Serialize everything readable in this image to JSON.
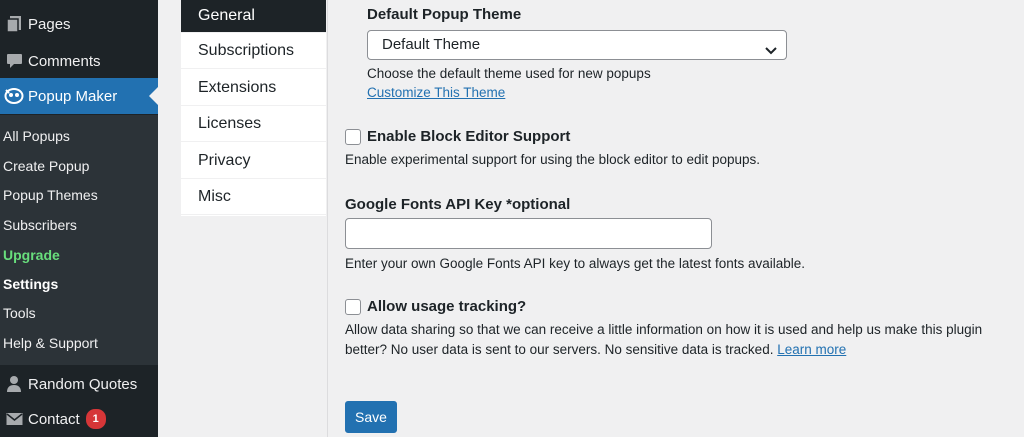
{
  "sidebar": {
    "menu": [
      {
        "label": "Pages",
        "icon": "pages-icon"
      },
      {
        "label": "Comments",
        "icon": "comments-icon"
      },
      {
        "label": "Popup Maker",
        "icon": "popup-maker-icon"
      }
    ],
    "submenu": [
      "All Popups",
      "Create Popup",
      "Popup Themes",
      "Subscribers",
      "Upgrade",
      "Settings",
      "Tools",
      "Help & Support"
    ],
    "bottom_menu": [
      {
        "label": "Random Quotes",
        "icon": "user-icon"
      },
      {
        "label": "Contact",
        "icon": "mail-icon",
        "badge": "1"
      }
    ],
    "colors": {
      "background": "#1d2327",
      "active": "#2271b1",
      "upgrade": "#68de7c"
    }
  },
  "tabs": [
    "General",
    "Subscriptions",
    "Extensions",
    "Licenses",
    "Privacy",
    "Misc"
  ],
  "settings": {
    "theme_label": "Default Popup Theme",
    "theme_value": "Default Theme",
    "theme_desc": "Choose the default theme used for new popups",
    "theme_link": "Customize This Theme",
    "block_editor_label": "Enable Block Editor Support",
    "block_editor_desc": "Enable experimental support for using the block editor to edit popups.",
    "fonts_label": "Google Fonts API Key *optional",
    "fonts_value": "",
    "fonts_desc": "Enter your own Google Fonts API key to always get the latest fonts available.",
    "tracking_label": "Allow usage tracking?",
    "tracking_desc_1": "Allow data sharing so that we can receive a little information on how it is used and help us make this plugin",
    "tracking_desc_2": "better? No user data is sent to our servers. No sensitive data is tracked.",
    "tracking_link": "Learn more",
    "save": "Save"
  }
}
